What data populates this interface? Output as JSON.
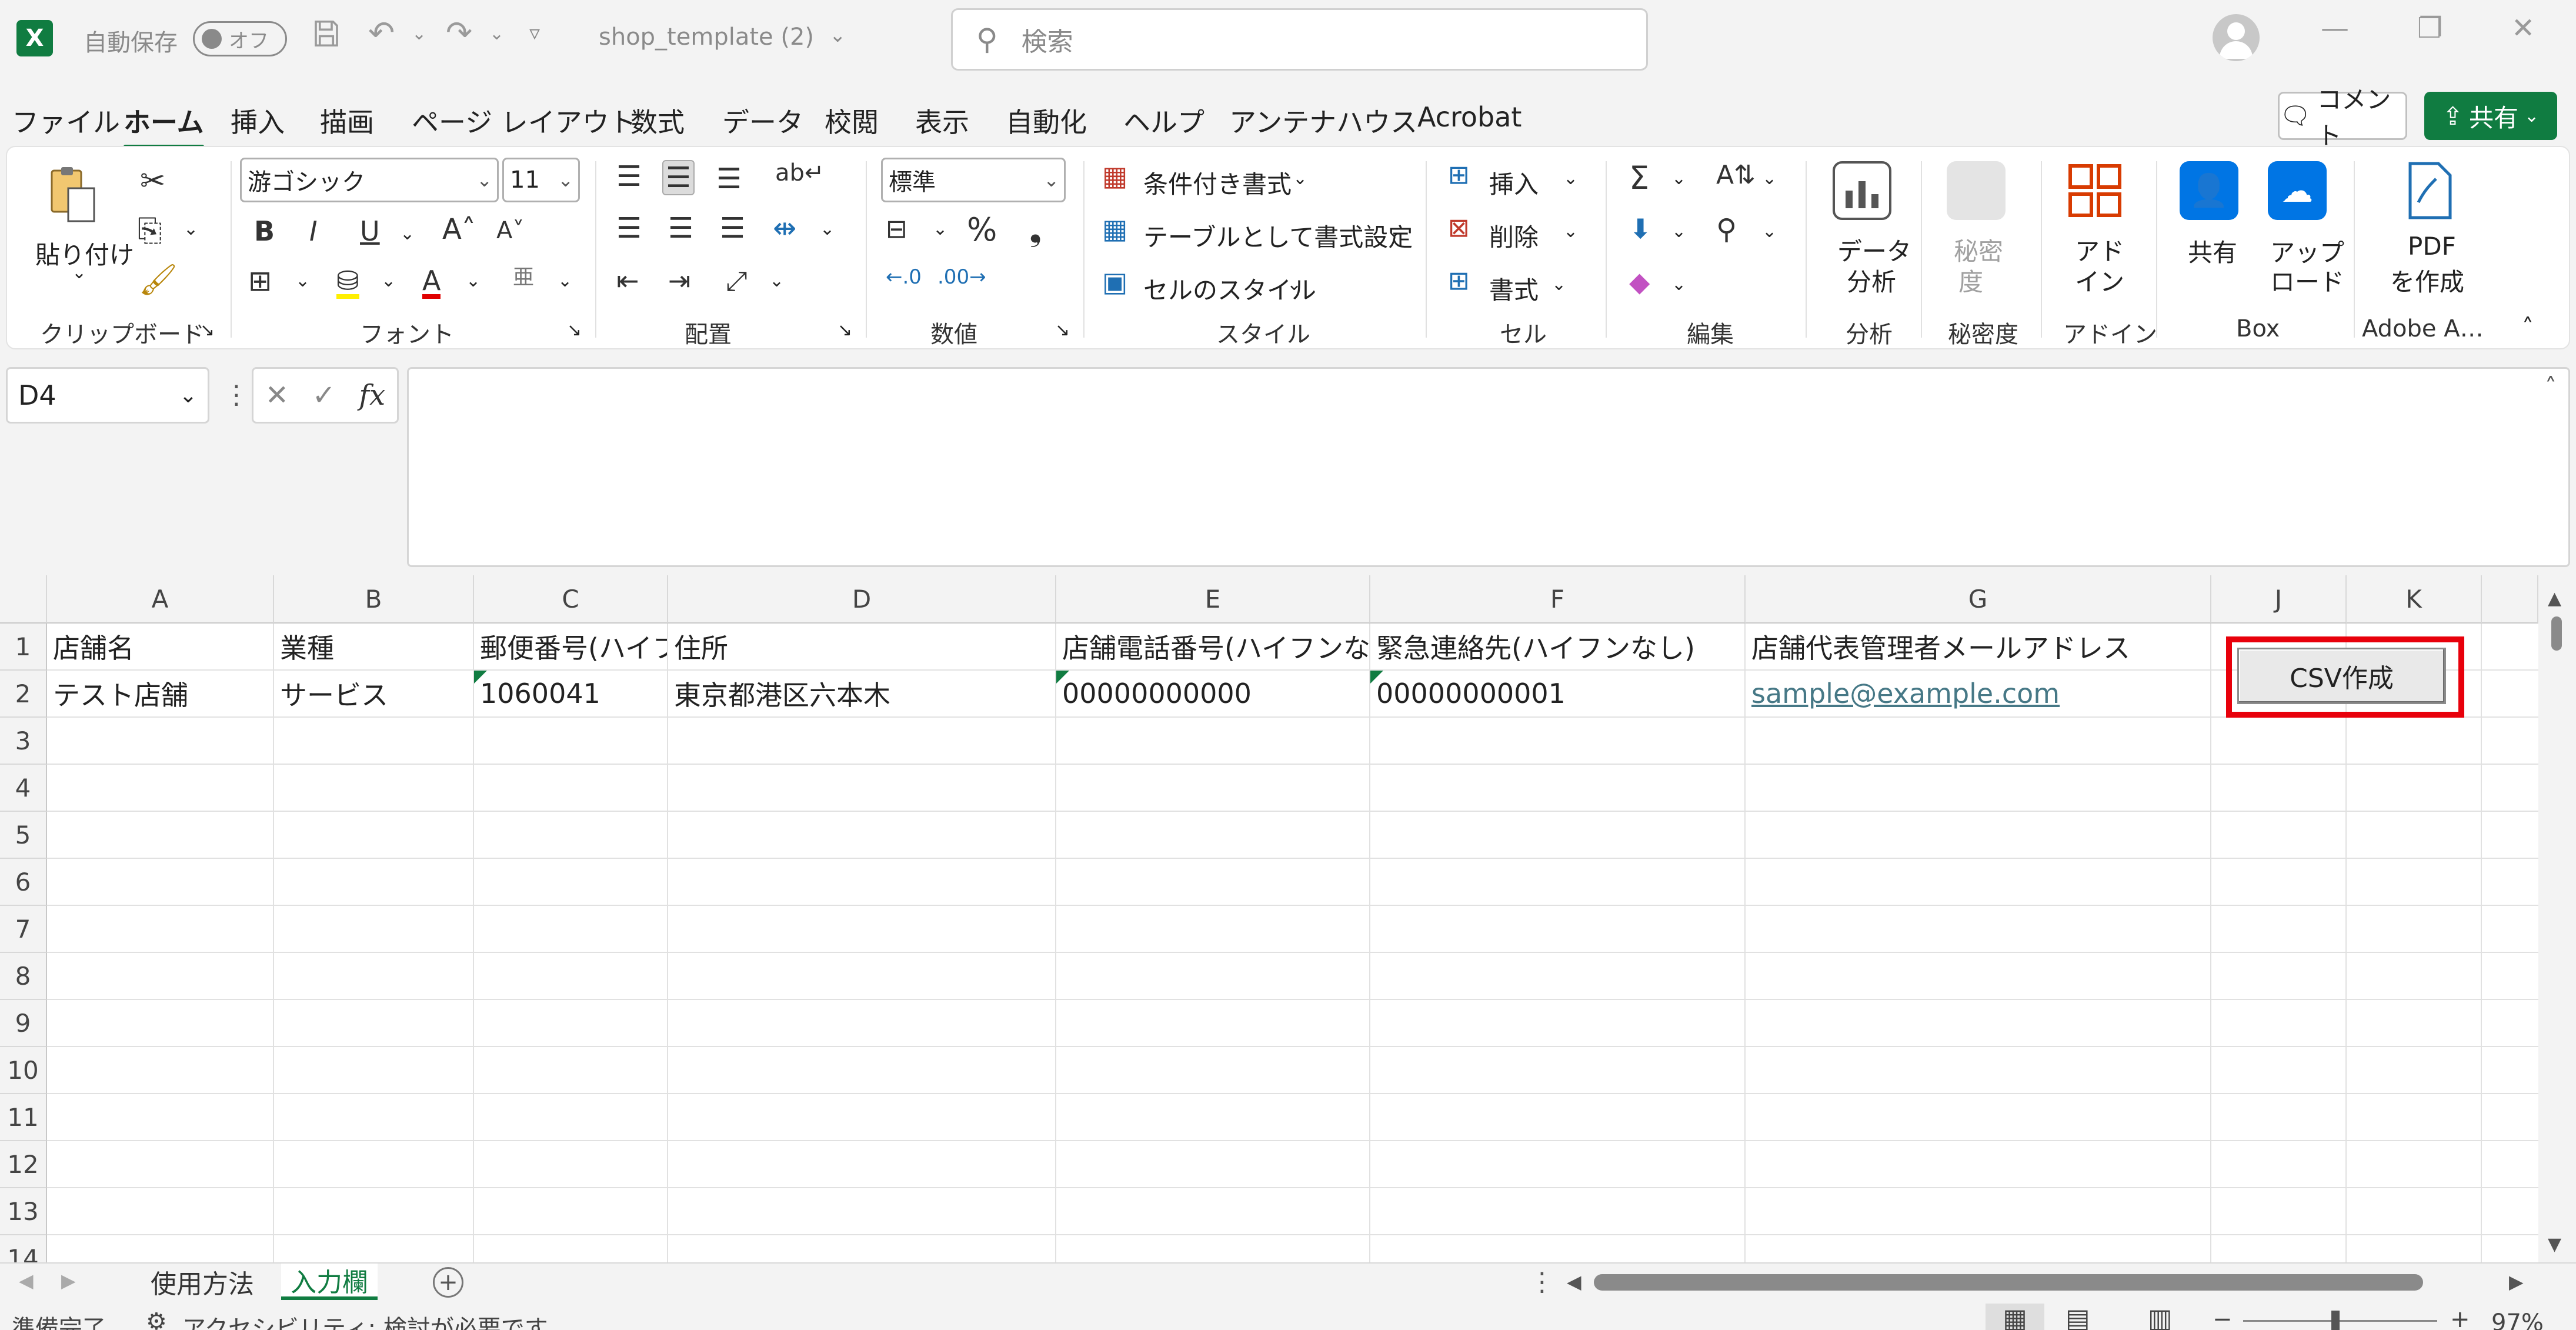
{
  "titlebar": {
    "autosave_label": "自動保存",
    "autosave_state": "オフ",
    "filename": "shop_template (2)",
    "search_placeholder": "検索"
  },
  "menu": {
    "items": [
      "ファイル",
      "ホーム",
      "挿入",
      "描画",
      "ページ レイアウト",
      "数式",
      "データ",
      "校閲",
      "表示",
      "自動化",
      "ヘルプ",
      "アンテナハウス",
      "Acrobat"
    ],
    "active": "ホーム",
    "comment_label": "コメント",
    "share_label": "共有"
  },
  "ribbon": {
    "clipboard": {
      "paste": "貼り付け",
      "label": "クリップボード"
    },
    "font": {
      "name": "游ゴシック",
      "size": "11",
      "label": "フォント",
      "bold": "B",
      "italic": "I",
      "underline": "U"
    },
    "alignment": {
      "label": "配置"
    },
    "number": {
      "format": "標準",
      "label": "数値"
    },
    "styles": {
      "conditional": "条件付き書式",
      "table": "テーブルとして書式設定",
      "cell_styles": "セルのスタイル",
      "label": "スタイル"
    },
    "cells": {
      "insert": "挿入",
      "delete": "削除",
      "format": "書式",
      "label": "セル"
    },
    "editing": {
      "label": "編集"
    },
    "analysis": {
      "btn_line1": "データ",
      "btn_line2": "分析",
      "label": "分析"
    },
    "sensitivity": {
      "btn_line1": "秘密",
      "btn_line2": "度",
      "label": "秘密度"
    },
    "addins": {
      "btn_line1": "アド",
      "btn_line2": "イン",
      "label": "アドイン"
    },
    "box": {
      "share": "共有",
      "upload_line1": "アップ",
      "upload_line2": "ロード",
      "label": "Box"
    },
    "adobe": {
      "btn_line1": "PDF",
      "btn_line2": "を作成",
      "label": "Adobe A…"
    }
  },
  "formula_bar": {
    "name_box": "D4",
    "fx": "fx",
    "content": ""
  },
  "sheet": {
    "columns": [
      "A",
      "B",
      "C",
      "D",
      "E",
      "F",
      "G",
      "J",
      "K"
    ],
    "rows": [
      "1",
      "2",
      "3",
      "4",
      "5",
      "6",
      "7",
      "8",
      "9",
      "10",
      "11",
      "12",
      "13",
      "14"
    ],
    "header_row": {
      "A": "店舗名",
      "B": "業種",
      "C": "郵便番号(ハイフンなし)",
      "D": "住所",
      "E": "店舗電話番号(ハイフンなし)",
      "F": "緊急連絡先(ハイフンなし)",
      "G": "店舗代表管理者メールアドレス"
    },
    "data_row": {
      "A": "テスト店舗",
      "B": "サービス",
      "C": "1060041",
      "D": "東京都港区六本木",
      "E": "00000000000",
      "F": "00000000001",
      "G": "sample@example.com"
    },
    "csv_button": "CSV作成"
  },
  "tabs": {
    "items": [
      "使用方法",
      "入力欄"
    ],
    "active": "入力欄"
  },
  "status": {
    "ready": "準備完了",
    "accessibility": "アクセシビリティ: 検討が必要です",
    "zoom": "97%"
  },
  "colors": {
    "excel_green": "#107c41",
    "highlight_red": "#e8000b",
    "link": "#467886"
  }
}
